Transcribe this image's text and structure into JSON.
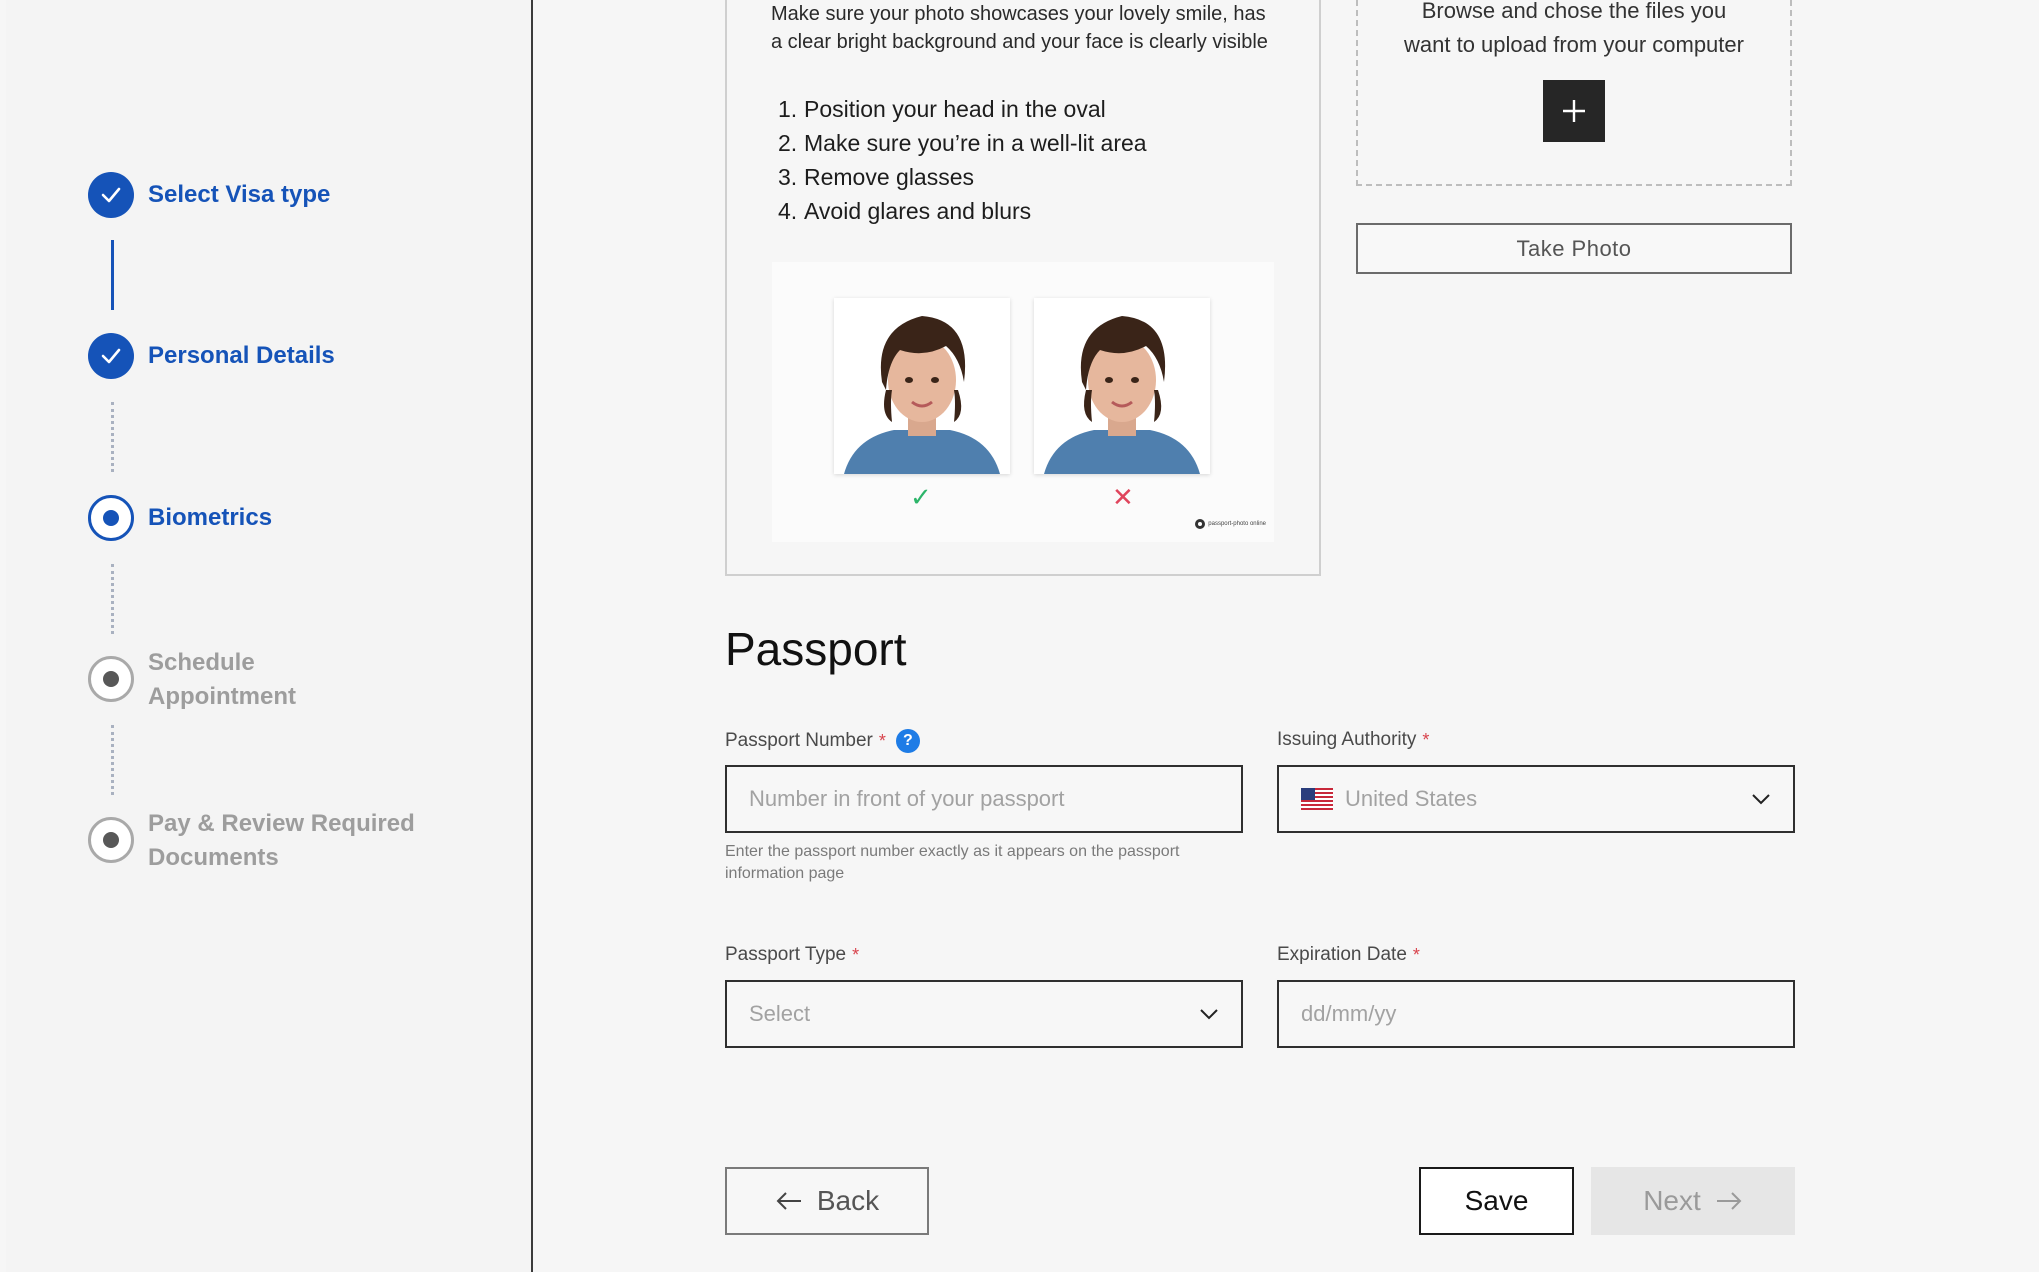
{
  "stepper": {
    "steps": [
      {
        "label": "Select Visa type",
        "status": "completed"
      },
      {
        "label": "Personal Details",
        "status": "completed"
      },
      {
        "label": "Biometrics",
        "status": "current"
      },
      {
        "label_line1": "Schedule",
        "label_line2": "Appointment",
        "status": "upcoming"
      },
      {
        "label_line1": "Pay & Review Required",
        "label_line2": "Documents",
        "status": "upcoming"
      }
    ]
  },
  "photo_instructions": {
    "intro_line1": "Make sure your photo showcases your lovely smile, has",
    "intro_line2": "a clear bright background and your face is clearly visible",
    "items": [
      {
        "num": "1.",
        "text": "Position your head in the oval"
      },
      {
        "num": "2.",
        "text": "Make sure you’re in a well-lit area"
      },
      {
        "num": "3.",
        "text": "Remove glasses"
      },
      {
        "num": "4.",
        "text": "Avoid glares and blurs"
      }
    ],
    "good_mark": "✓",
    "bad_mark": "✕",
    "logo_text": "passport-photo online"
  },
  "upload": {
    "text_line1": "Browse and chose the files you",
    "text_line2": "want to upload from your computer",
    "plus": "+",
    "take_photo_label": "Take Photo"
  },
  "passport": {
    "title": "Passport",
    "number": {
      "label": "Passport Number",
      "required": "*",
      "help": "?",
      "placeholder": "Number in front of your passport",
      "hint_line1": "Enter the passport number exactly as it appears on the passport",
      "hint_line2": "information page"
    },
    "authority": {
      "label": "Issuing Authority",
      "required": "*",
      "value": "United States",
      "flag_icon": "us-flag-icon"
    },
    "type": {
      "label": "Passport Type",
      "required": "*",
      "value": "Select"
    },
    "expiration": {
      "label": "Expiration Date",
      "required": "*",
      "placeholder": "dd/mm/yy"
    }
  },
  "actions": {
    "back_label": "Back",
    "save_label": "Save",
    "next_label": "Next"
  },
  "colors": {
    "primary": "#1553b8",
    "required": "#d8434c",
    "help": "#1e7ce6",
    "ok": "#2db56a",
    "bad": "#e0455d"
  }
}
